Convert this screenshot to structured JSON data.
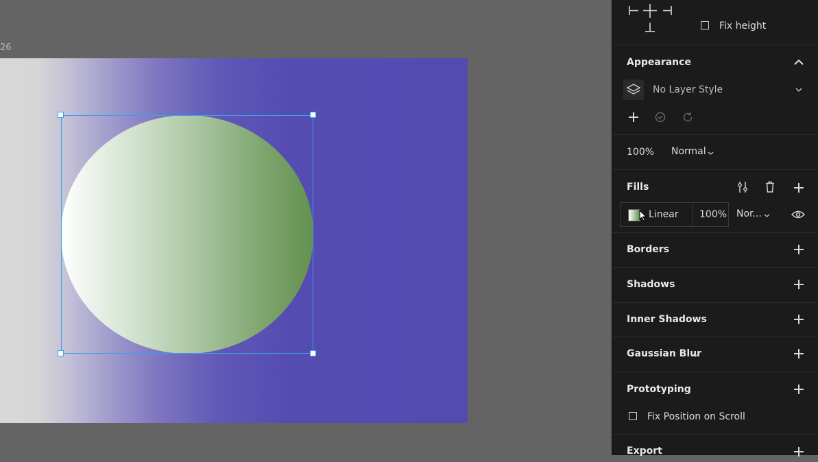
{
  "canvas": {
    "artboard_label": "26"
  },
  "resizing": {
    "fix_height_label": "Fix height"
  },
  "appearance": {
    "title": "Appearance",
    "layer_style": "No Layer Style"
  },
  "layer": {
    "opacity": "100%",
    "blend_mode": "Normal"
  },
  "fills": {
    "title": "Fills",
    "fill_type": "Linear",
    "fill_opacity": "100%",
    "fill_blend": "Nor...",
    "swatch_colors": [
      "#ffffff",
      "#64914f"
    ]
  },
  "borders": {
    "title": "Borders"
  },
  "shadows": {
    "title": "Shadows"
  },
  "inner_shadows": {
    "title": "Inner Shadows"
  },
  "gaussian_blur": {
    "title": "Gaussian Blur"
  },
  "prototyping": {
    "title": "Prototyping",
    "fix_position_label": "Fix Position on Scroll"
  },
  "export": {
    "title": "Export"
  },
  "colors": {
    "selection": "#3aa0ee",
    "artboard_purple": "#554cb2",
    "panel_bg": "#1b1b1b"
  }
}
